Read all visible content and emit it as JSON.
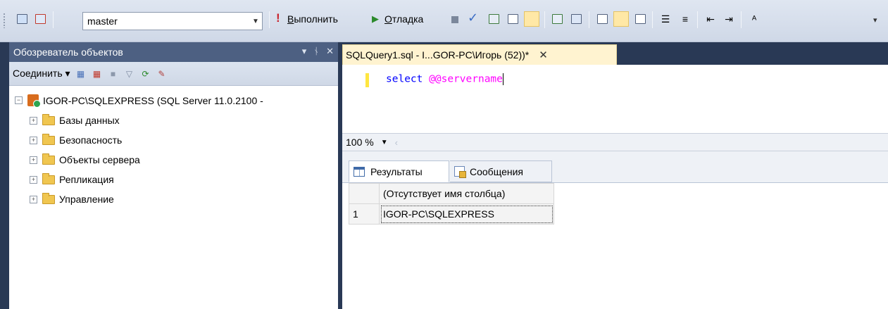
{
  "toolbar": {
    "database": "master",
    "execute_label_underlined": "В",
    "execute_label_rest": "ыполнить",
    "debug_label_underlined": "О",
    "debug_label_rest": "тладка"
  },
  "object_explorer": {
    "title": "Обозреватель объектов",
    "pin_glyph": "▾ ⊥ ✕",
    "connect_label": "Соединить ▾",
    "server_node": "IGOR-PC\\SQLEXPRESS (SQL Server 11.0.2100 -",
    "folders": [
      {
        "label": "Базы данных"
      },
      {
        "label": "Безопасность"
      },
      {
        "label": "Объекты сервера"
      },
      {
        "label": "Репликация"
      },
      {
        "label": "Управление"
      }
    ]
  },
  "editor": {
    "tab_title": "SQLQuery1.sql - I...GOR-PC\\Игорь (52))*",
    "keyword": "select",
    "function": "@@servername",
    "zoom": "100 %"
  },
  "results": {
    "tab_results": "Результаты",
    "tab_messages": "Сообщения",
    "column_header": "(Отсутствует имя столбца)",
    "rows": [
      {
        "num": "1",
        "value": "IGOR-PC\\SQLEXPRESS"
      }
    ]
  },
  "colors": {
    "frame": "#293955",
    "panel_title": "#4d6082",
    "doc_tab": "#fff3d0",
    "keyword": "#0000ff",
    "function": "#ff00ff",
    "change_bar": "#ffe640"
  }
}
